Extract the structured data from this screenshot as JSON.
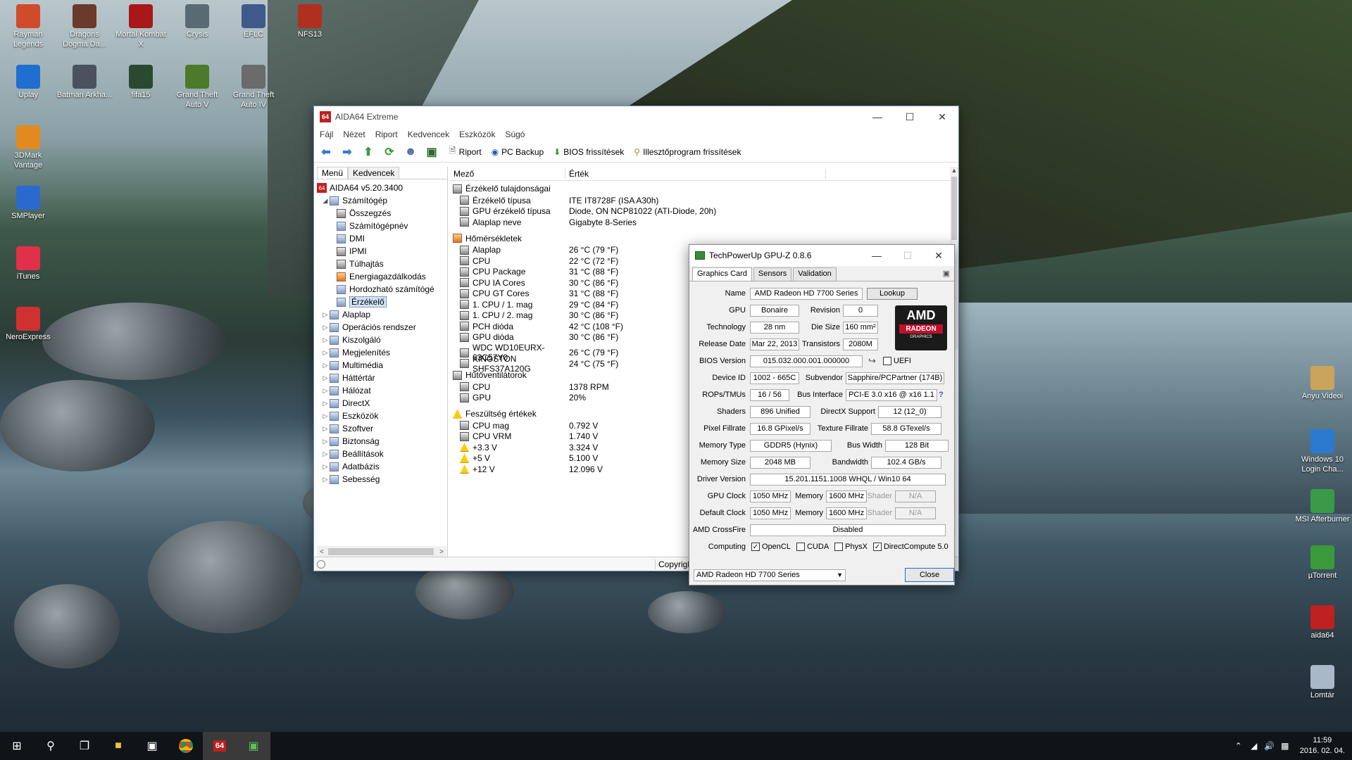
{
  "desktop": {
    "left_icons": [
      {
        "label": "Rayman Legends",
        "color": "#d04b2a"
      },
      {
        "label": "Dragons Dogma Da...",
        "color": "#6b3a2a"
      },
      {
        "label": "Mortal Kombat X",
        "color": "#a81818"
      },
      {
        "label": "Crysis",
        "color": "#5a6a72"
      },
      {
        "label": "EFLC",
        "color": "#3d5a8a"
      },
      {
        "label": "NFS13",
        "color": "#b03020"
      },
      {
        "label": "Uplay",
        "color": "#1f6fd0"
      },
      {
        "label": "Batman Arkha...",
        "color": "#4a5260"
      },
      {
        "label": "fifa15",
        "color": "#2a4a30"
      },
      {
        "label": "Grand Theft Auto V",
        "color": "#4c7a2a"
      },
      {
        "label": "Grand Theft Auto IV",
        "color": "#6b6b6b"
      },
      {
        "label": "3DMark Vantage",
        "color": "#e08a20"
      },
      {
        "label": "SMPlayer",
        "color": "#2a6ad0"
      },
      {
        "label": "iTunes",
        "color": "#e0304a"
      },
      {
        "label": "NeroExpress",
        "color": "#d03030"
      }
    ],
    "right_icons": [
      {
        "label": "Anyu Videoi",
        "color": "#caa45a"
      },
      {
        "label": "Windows 10 Login Cha...",
        "color": "#2a7ad0"
      },
      {
        "label": "MSI Afterburner",
        "color": "#3a9a4a"
      },
      {
        "label": "µTorrent",
        "color": "#3a9a3a"
      },
      {
        "label": "aida64",
        "color": "#c02020"
      },
      {
        "label": "Lomtár",
        "color": "#a8b8c8"
      }
    ]
  },
  "aida": {
    "title": "AIDA64 Extreme",
    "menu": [
      "Fájl",
      "Nézet",
      "Riport",
      "Kedvencek",
      "Eszközök",
      "Súgó"
    ],
    "toolbar": {
      "report": "Riport",
      "backup": "PC Backup",
      "bios": "BIOS frissítések",
      "driver": "Illesztőprogram frissítések"
    },
    "tabs": [
      "Menü",
      "Kedvencek"
    ],
    "tree_root": "AIDA64 v5.20.3400",
    "tree": [
      {
        "label": "Számítógép",
        "level": 1,
        "open": true
      },
      {
        "label": "Összegzés",
        "level": 2
      },
      {
        "label": "Számítógépnév",
        "level": 2
      },
      {
        "label": "DMI",
        "level": 2
      },
      {
        "label": "IPMI",
        "level": 2
      },
      {
        "label": "Túlhajtás",
        "level": 2
      },
      {
        "label": "Energiagazdálkodás",
        "level": 2
      },
      {
        "label": "Hordozható számítógé",
        "level": 2
      },
      {
        "label": "Érzékelő",
        "level": 2,
        "selected": true
      },
      {
        "label": "Alaplap",
        "level": 1
      },
      {
        "label": "Operációs rendszer",
        "level": 1
      },
      {
        "label": "Kiszolgáló",
        "level": 1
      },
      {
        "label": "Megjelenítés",
        "level": 1
      },
      {
        "label": "Multimédia",
        "level": 1
      },
      {
        "label": "Háttértár",
        "level": 1
      },
      {
        "label": "Hálózat",
        "level": 1
      },
      {
        "label": "DirectX",
        "level": 1
      },
      {
        "label": "Eszközök",
        "level": 1
      },
      {
        "label": "Szoftver",
        "level": 1
      },
      {
        "label": "Biztonság",
        "level": 1
      },
      {
        "label": "Beállítások",
        "level": 1
      },
      {
        "label": "Adatbázis",
        "level": 1
      },
      {
        "label": "Sebesség",
        "level": 1
      }
    ],
    "col_field": "Mező",
    "col_value": "Érték",
    "sections": [
      {
        "title": "Érzékelő tulajdonságai",
        "rows": [
          [
            "Érzékelő típusa",
            "ITE IT8728F  (ISA A30h)"
          ],
          [
            "GPU érzékelő típusa",
            "Diode, ON NCP81022  (ATI-Diode, 20h)"
          ],
          [
            "Alaplap neve",
            "Gigabyte 8-Series"
          ]
        ]
      },
      {
        "title": "Hőmérsékletek",
        "rows": [
          [
            "Alaplap",
            "26 °C  (79 °F)"
          ],
          [
            "CPU",
            "22 °C  (72 °F)"
          ],
          [
            "CPU Package",
            "31 °C  (88 °F)"
          ],
          [
            "CPU IA Cores",
            "30 °C  (86 °F)"
          ],
          [
            "CPU GT Cores",
            "31 °C  (88 °F)"
          ],
          [
            "1. CPU / 1. mag",
            "29 °C  (84 °F)"
          ],
          [
            "1. CPU / 2. mag",
            "30 °C  (86 °F)"
          ],
          [
            "PCH dióda",
            "42 °C  (108 °F)"
          ],
          [
            "GPU dióda",
            "30 °C  (86 °F)"
          ],
          [
            "WDC WD10EURX-63C57Y0",
            "26 °C  (79 °F)"
          ],
          [
            "KINGSTON SHFS37A120G",
            "24 °C  (75 °F)"
          ]
        ]
      },
      {
        "title": "Hűtőventilátorok",
        "rows": [
          [
            "CPU",
            "1378 RPM"
          ],
          [
            "GPU",
            "20%"
          ]
        ]
      },
      {
        "title": "Feszültség értékek",
        "rows": [
          [
            "CPU mag",
            "0.792 V"
          ],
          [
            "CPU VRM",
            "1.740 V"
          ],
          [
            "+3.3 V",
            "3.324 V"
          ],
          [
            "+5 V",
            "5.100 V"
          ],
          [
            "+12 V",
            "12.096 V"
          ]
        ]
      }
    ],
    "status_copyright": "Copyrigh"
  },
  "gpuz": {
    "title": "TechPowerUp GPU-Z 0.8.6",
    "tabs": [
      "Graphics Card",
      "Sensors",
      "Validation"
    ],
    "name_label": "Name",
    "name": "AMD Radeon HD 7700 Series",
    "lookup": "Lookup",
    "gpu_label": "GPU",
    "gpu": "Bonaire",
    "revision_label": "Revision",
    "revision": "0",
    "tech_label": "Technology",
    "tech": "28 nm",
    "die_label": "Die Size",
    "die": "160 mm²",
    "release_label": "Release Date",
    "release": "Mar 22, 2013",
    "trans_label": "Transistors",
    "trans": "2080M",
    "bios_label": "BIOS Version",
    "bios": "015.032.000.001.000000",
    "uefi": "UEFI",
    "devid_label": "Device ID",
    "devid": "1002 - 665C",
    "subv_label": "Subvendor",
    "subv": "Sapphire/PCPartner (174B)",
    "rops_label": "ROPs/TMUs",
    "rops": "16 / 56",
    "bus_label": "Bus Interface",
    "bus": "PCI-E 3.0 x16 @ x16 1.1",
    "help": "?",
    "shaders_label": "Shaders",
    "shaders": "896 Unified",
    "dx_label": "DirectX Support",
    "dx": "12 (12_0)",
    "pix_label": "Pixel Fillrate",
    "pix": "16.8 GPixel/s",
    "tex_label": "Texture Fillrate",
    "tex": "58.8 GTexel/s",
    "memtype_label": "Memory Type",
    "memtype": "GDDR5 (Hynix)",
    "bw_label": "Bus Width",
    "bw": "128 Bit",
    "memsize_label": "Memory Size",
    "memsize": "2048 MB",
    "band_label": "Bandwidth",
    "band": "102.4 GB/s",
    "driver_label": "Driver Version",
    "driver": "15.201.1151.1008 WHQL / Win10 64",
    "gpuclock_label": "GPU Clock",
    "gpuclock": "1050 MHz",
    "mem_label": "Memory",
    "memclock": "1600 MHz",
    "shader_label": "Shader",
    "shader": "N/A",
    "defclock_label": "Default Clock",
    "defclock": "1050 MHz",
    "defmem": "1600 MHz",
    "defshader": "N/A",
    "cf_label": "AMD CrossFire",
    "cf": "Disabled",
    "computing_label": "Computing",
    "opencl": "OpenCL",
    "cuda": "CUDA",
    "physx": "PhysX",
    "dc": "DirectCompute 5.0",
    "select": "AMD Radeon HD 7700 Series",
    "close": "Close",
    "logo_top": "AMD",
    "logo_mid": "RADEON",
    "logo_bot": "GRAPHICS"
  },
  "tray": {
    "time": "11:59",
    "date": "2016. 02. 04."
  }
}
